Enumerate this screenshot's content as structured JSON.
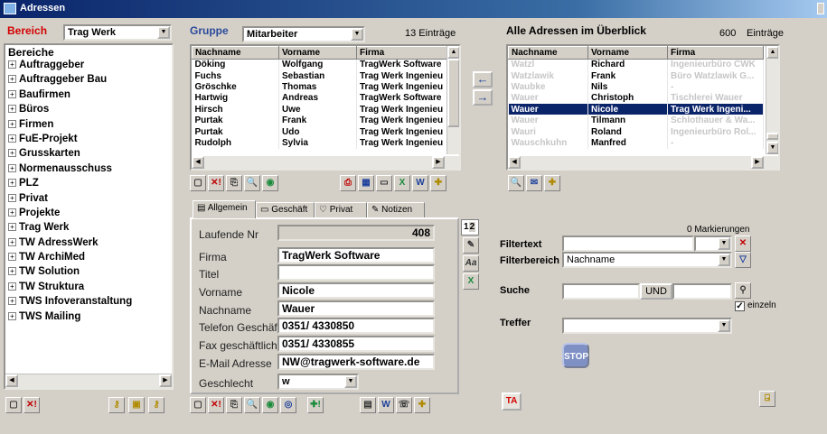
{
  "window": {
    "title": "Adressen"
  },
  "left": {
    "label": "Bereich",
    "selected": "Trag Werk",
    "tree_root": "Bereiche",
    "tree_items": [
      "Auftraggeber",
      "Auftraggeber Bau",
      "Baufirmen",
      "Büros",
      "Firmen",
      "FuE-Projekt",
      "Grusskarten",
      "Normenausschuss",
      "PLZ",
      "Privat",
      "Projekte",
      "Trag Werk",
      "TW AdressWerk",
      "TW ArchiMed",
      "TW Solution",
      "TW Struktura",
      "TWS Infoveranstaltung",
      "TWS Mailing"
    ]
  },
  "group": {
    "label": "Gruppe",
    "selected": "Mitarbeiter",
    "count": "13 Einträge",
    "columns": [
      "Nachname",
      "Vorname",
      "Firma"
    ],
    "rows": [
      [
        "Döking",
        "Wolfgang",
        "TragWerk Software"
      ],
      [
        "Fuchs",
        "Sebastian",
        "Trag Werk Ingenieu"
      ],
      [
        "Gröschke",
        "Thomas",
        "Trag Werk Ingenieu"
      ],
      [
        "Hartwig",
        "Andreas",
        "TragWerk Software"
      ],
      [
        "Hirsch",
        "Uwe",
        "Trag Werk Ingenieu"
      ],
      [
        "Purtak",
        "Frank",
        "Trag Werk Ingenieu"
      ],
      [
        "Purtak",
        "Udo",
        "Trag Werk Ingenieu"
      ],
      [
        "Rudolph",
        "Sylvia",
        "Trag Werk Ingenieu"
      ]
    ]
  },
  "all": {
    "label": "Alle Adressen im Überblick",
    "count": "600",
    "count_unit": "Einträge",
    "columns": [
      "Nachname",
      "Vorname",
      "Firma"
    ],
    "rows": [
      [
        "Watzl",
        "Richard",
        "Ingenieurbüro CWK"
      ],
      [
        "Watzlawik",
        "Frank",
        "Büro Watzlawik G..."
      ],
      [
        "Waubke",
        "Nils",
        "-"
      ],
      [
        "Wauer",
        "Christoph",
        "Tischlerei Wauer"
      ],
      [
        "Wauer",
        "Nicole",
        "Trag Werk Ingeni..."
      ],
      [
        "Wauer",
        "Tilmann",
        "Schlothauer & Wa..."
      ],
      [
        "Wauri",
        "Roland",
        "Ingenieurbüro Rol..."
      ],
      [
        "Wauschkuhn",
        "Manfred",
        "-"
      ]
    ],
    "selected_index": 4
  },
  "tabs": [
    "Allgemein",
    "Geschäft",
    "Privat",
    "Notizen"
  ],
  "pages": [
    "1",
    "2"
  ],
  "form": {
    "laufende_nr_label": "Laufende Nr",
    "laufende_nr": "408",
    "firma_label": "Firma",
    "firma": "TragWerk Software",
    "titel_label": "Titel",
    "titel": "",
    "vorname_label": "Vorname",
    "vorname": "Nicole",
    "nachname_label": "Nachname",
    "nachname": "Wauer",
    "tel_label": "Telefon Geschäft",
    "tel": "0351/ 4330850",
    "fax_label": "Fax geschäftlich",
    "fax": "0351/ 4330855",
    "email_label": "E-Mail Adresse",
    "email": "NW@tragwerk-software.de",
    "geschlecht_label": "Geschlecht",
    "geschlecht": "w"
  },
  "filter": {
    "markierungen": "0 Markierungen",
    "filtertext_label": "Filtertext",
    "filterbereich_label": "Filterbereich",
    "filterbereich": "Nachname",
    "suche_label": "Suche",
    "und": "UND",
    "einzeln": "einzeln",
    "treffer_label": "Treffer",
    "stop": "STOP",
    "ta": "TA"
  }
}
